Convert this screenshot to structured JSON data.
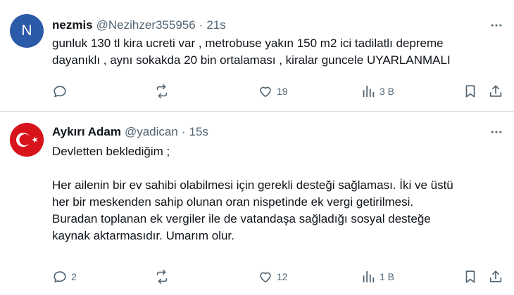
{
  "tweets": [
    {
      "avatar_letter": "N",
      "name": "nezmis",
      "handle": "@Nezihzer355956",
      "separator": "·",
      "time": "21s",
      "text_lines": [
        "gunluk 130 tl kira ucreti var , metrobuse yakın 150 m2 ici tadilatlı depreme",
        "dayanıklı , aynı sokakda 20 bin ortalaması , kiralar guncele UYARLANMALI"
      ],
      "replies": "",
      "retweets": "",
      "likes": "19",
      "views": "3 B"
    },
    {
      "name": "Aykırı Adam",
      "handle": "@yadican",
      "separator": "·",
      "time": "15s",
      "text_line1": "Devletten beklediğim ;",
      "text_lines": [
        "Her ailenin bir ev sahibi olabilmesi için gerekli desteği sağlaması. İki ve üstü",
        "her bir meskenden sahip olunan oran nispetinde ek vergi getirilmesi.",
        "Buradan toplanan ek vergiler ile de vatandaşa sağladığı sosyal desteğe",
        "kaynak aktarmasıdır. Umarım olur."
      ],
      "replies": "2",
      "retweets": "",
      "likes": "12",
      "views": "1 B"
    }
  ],
  "colors": {
    "text": "#0f1419",
    "secondary": "#536471",
    "divider": "#d6dbe0",
    "avatar_n": "#2b5aa8",
    "flag_red": "#d7141c"
  },
  "icons": [
    "more-icon",
    "reply-icon",
    "retweet-icon",
    "like-icon",
    "views-icon",
    "bookmark-icon",
    "share-icon"
  ]
}
